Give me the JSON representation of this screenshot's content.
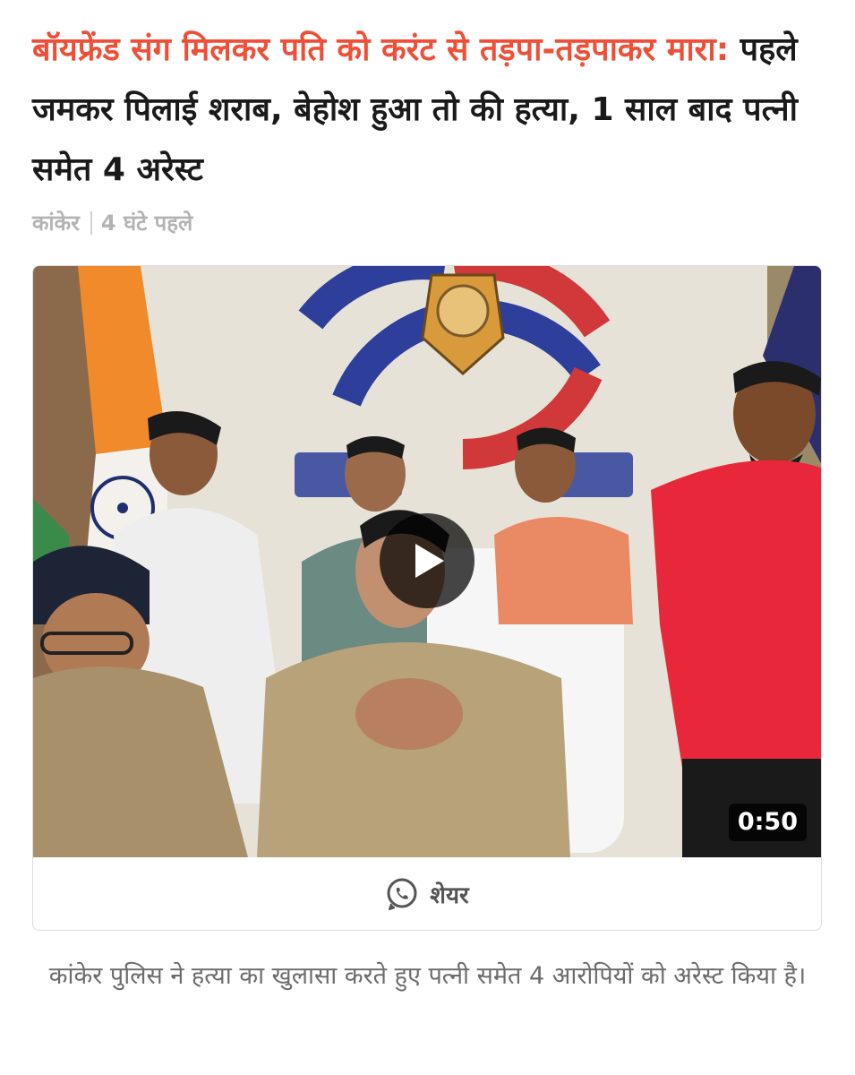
{
  "article": {
    "headline_accent": "बॉयफ्रेंड संग मिलकर पति को करंट से तड़पा-तड़पाकर मारा:",
    "headline_rest": " पहले जमकर पिलाई शराब, बेहोश हुआ तो की हत्या, 1 साल बाद पत्नी समेत 4 अरेस्ट",
    "location": "कांकेर",
    "time": "4 घंटे पहले",
    "video": {
      "duration": "0:50",
      "share_label": "शेयर"
    },
    "caption": "कांकेर पुलिस ने हत्या का खुलासा करते हुए पत्नी समेत 4 आरोपियों को अरेस्ट किया है।"
  },
  "icons": {
    "play": "play-icon",
    "share": "whatsapp-icon"
  },
  "colors": {
    "accent": "#f04e37",
    "headline": "#1a1a1a",
    "meta": "#b3b3b3",
    "caption": "#6b6b6b"
  }
}
